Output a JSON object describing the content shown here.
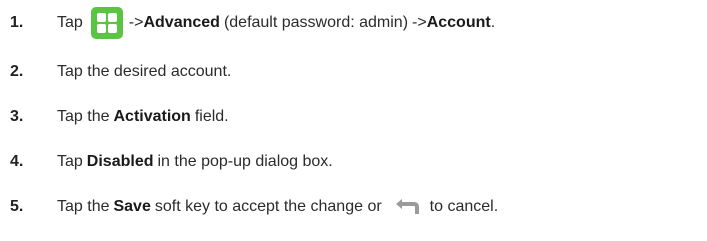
{
  "steps": [
    {
      "number": "1.",
      "parts": {
        "tap": "Tap",
        "arrow1": "->",
        "advanced": "Advanced",
        "password_note": "(default password: admin)",
        "arrow2": "->",
        "account": "Account",
        "end": "."
      },
      "icon": "menu-grid-icon"
    },
    {
      "number": "2.",
      "parts": {
        "text": "Tap the desired account."
      }
    },
    {
      "number": "3.",
      "parts": {
        "pre": "Tap the",
        "bold": "Activation",
        "post": "field."
      }
    },
    {
      "number": "4.",
      "parts": {
        "pre": "Tap",
        "bold": "Disabled",
        "post": "in the pop-up dialog box."
      }
    },
    {
      "number": "5.",
      "parts": {
        "pre": "Tap the",
        "bold": "Save",
        "mid": "soft key to accept the change or",
        "post": "to cancel."
      },
      "icon": "back-arrow-icon"
    }
  ],
  "colors": {
    "menu_icon": "#5cc443",
    "back_icon": "#9a9a9a",
    "text": "#2b2b2b"
  }
}
